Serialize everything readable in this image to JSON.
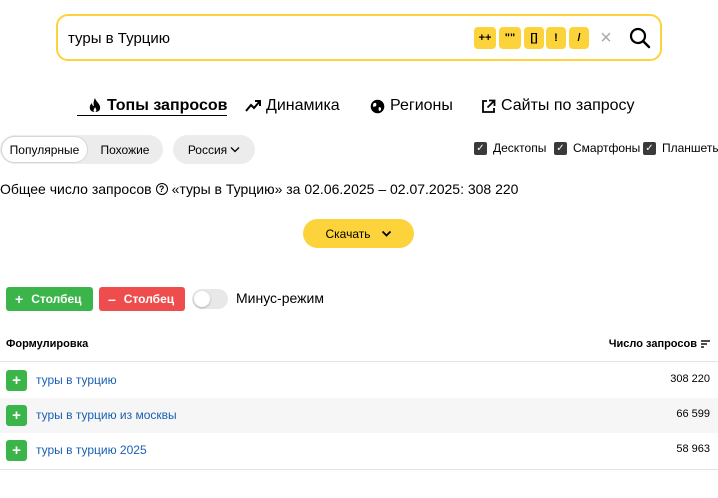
{
  "search": {
    "value": "туры в Турцию",
    "operators": [
      "++",
      "\"\"",
      "[]",
      "!",
      "/"
    ]
  },
  "tabs": [
    {
      "label": "Топы запросов",
      "icon": "fire-icon",
      "active": true
    },
    {
      "label": "Динамика",
      "icon": "trend-icon",
      "active": false
    },
    {
      "label": "Регионы",
      "icon": "globe-icon",
      "active": false
    },
    {
      "label": "Сайты по запросу",
      "icon": "external-link-icon",
      "active": false
    }
  ],
  "filters": {
    "popular": "Популярные",
    "similar": "Похожие",
    "region": "Россия",
    "devices": [
      {
        "label": "Десктопы",
        "checked": true
      },
      {
        "label": "Смартфоны",
        "checked": true
      },
      {
        "label": "Планшеты",
        "checked": true
      }
    ]
  },
  "summary": {
    "prefix": "Общее число запросов",
    "suffix": "«туры в Турцию» за 02.06.2025 – 02.07.2025: 308 220"
  },
  "download_label": "Скачать",
  "actions": {
    "add_column": "Столбец",
    "remove_column": "Столбец",
    "minus_mode": "Минус-режим"
  },
  "table": {
    "headers": {
      "phrase": "Формулировка",
      "count": "Число запросов"
    },
    "rows": [
      {
        "phrase": "туры в турцию",
        "count": "308 220"
      },
      {
        "phrase": "туры в турцию из москвы",
        "count": "66 599"
      },
      {
        "phrase": "туры в турцию 2025",
        "count": "58 963"
      }
    ]
  },
  "colors": {
    "accent_yellow": "#fdd33b",
    "add_green": "#3bb54a",
    "remove_red": "#ef4d4d",
    "link_blue": "#1a5fb4"
  }
}
